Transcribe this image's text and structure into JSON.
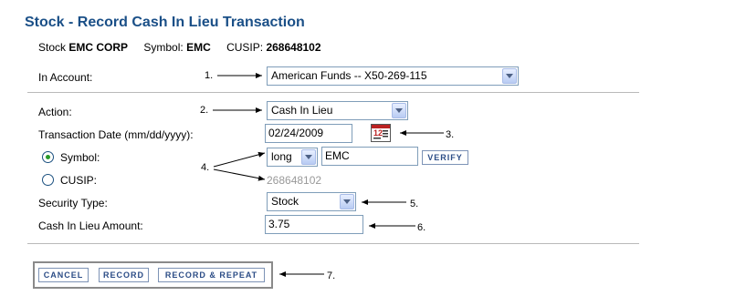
{
  "page": {
    "title": "Stock - Record Cash In Lieu Transaction"
  },
  "info": {
    "stock_label": "Stock",
    "stock_value": "EMC CORP",
    "symbol_label": "Symbol:",
    "symbol_value": "EMC",
    "cusip_label": "CUSIP:",
    "cusip_value": "268648102"
  },
  "form": {
    "account_label": "In Account:",
    "account_value": "American Funds -- X50-269-115",
    "action_label": "Action:",
    "action_value": "Cash In Lieu",
    "date_label": "Transaction Date (mm/dd/yyyy):",
    "date_value": "02/24/2009",
    "calendar_icon_text": "12",
    "symbol_radio_label": "Symbol:",
    "cusip_radio_label": "CUSIP:",
    "position_value": "long",
    "symbol_input_value": "EMC",
    "verify_label": "VERIFY",
    "cusip_readonly_value": "268648102",
    "security_type_label": "Security Type:",
    "security_type_value": "Stock",
    "amount_label": "Cash In Lieu Amount:",
    "amount_value": "3.75"
  },
  "buttons": {
    "cancel": "CANCEL",
    "record": "RECORD",
    "record_repeat": "RECORD & REPEAT"
  },
  "annotations": [
    "1.",
    "2.",
    "3.",
    "4.",
    "5.",
    "6.",
    "7."
  ],
  "icons": {
    "calendar": "calendar-icon",
    "dropdown": "chevron-down-icon"
  },
  "colors": {
    "title": "#1a4f87",
    "button_text": "#2b4c86",
    "input_border": "#7f9db9"
  }
}
